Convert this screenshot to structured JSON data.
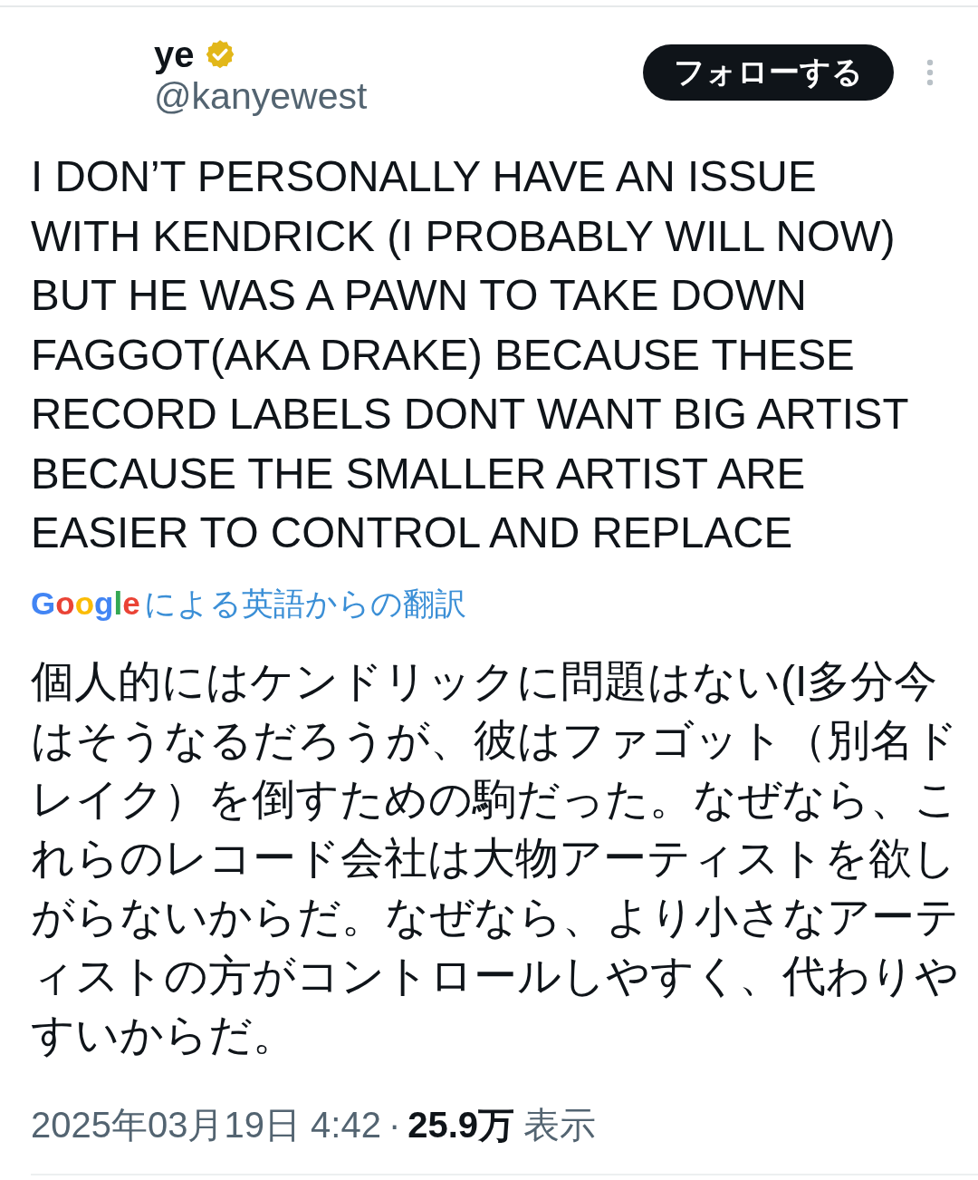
{
  "author": {
    "name": "ye",
    "verified": true,
    "handle": "@kanyewest"
  },
  "follow_button": {
    "label": "フォローする"
  },
  "post": {
    "text": "I DON’T PERSONALLY HAVE AN ISSUE WITH KENDRICK (I PROBABLY WILL NOW) BUT HE WAS A PAWN TO TAKE DOWN FAGGOT(AKA DRAKE) BECAUSE THESE RECORD LABELS DONT WANT BIG ARTIST BECAUSE THE SMALLER ARTIST ARE EASIER TO CONTROL AND REPLACE",
    "translation_note": {
      "brand": "Google",
      "label": "による英語からの翻訳"
    },
    "translated_text": "個人的にはケンドリックに問題はない(I多分今はそうなるだろうが、彼はファゴット（別名ドレイク）を倒すための駒だった。なぜなら、これらのレコード会社は大物アーティストを欲しがらないからだ。なぜなら、より小さなアーティストの方がコントロールしやすく、代わりやすいからだ。"
  },
  "meta": {
    "timestamp": "2025年03月19日 4:42",
    "separator": "·",
    "views_count": "25.9万",
    "views_label": "表示"
  }
}
